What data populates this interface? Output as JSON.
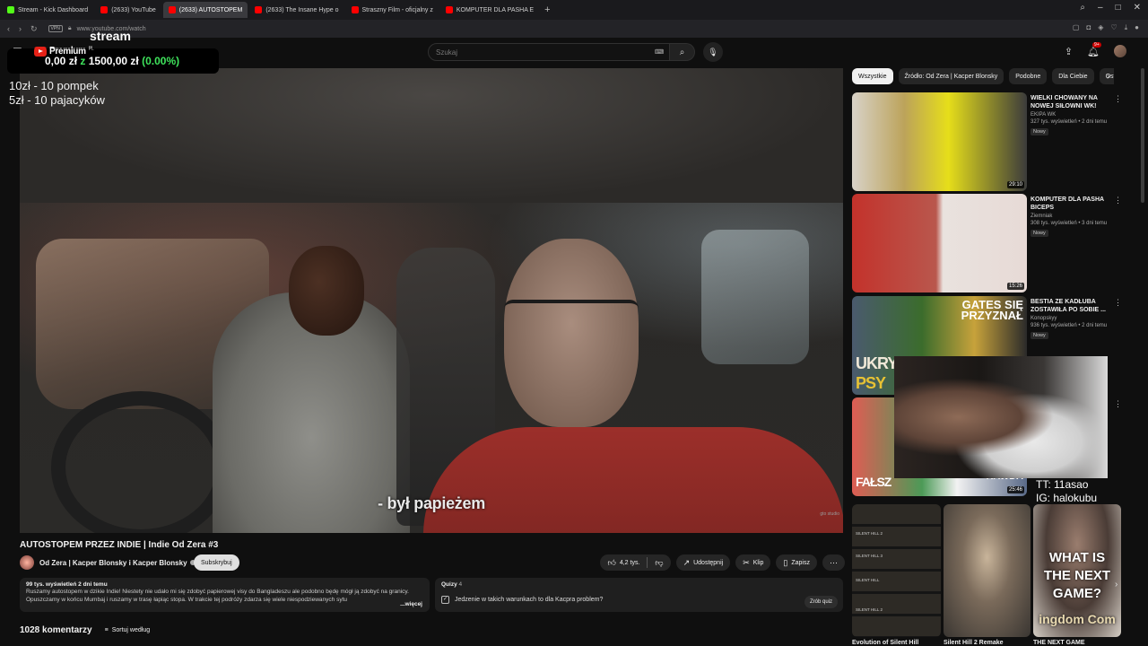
{
  "browser": {
    "tabs": [
      {
        "label": "Stream - Kick Dashboard",
        "color": "#53fc18"
      },
      {
        "label": "(2633) YouTube",
        "color": "#ff0000"
      },
      {
        "label": "(2633) AUTOSTOPEM",
        "color": "#ff0000"
      },
      {
        "label": "(2633) The Insane Hype o",
        "color": "#ff0000"
      },
      {
        "label": "Straszny Film - oficjalny z",
        "color": "#ff0000"
      },
      {
        "label": "KOMPUTER DLA PASHA E",
        "color": "#ff0000"
      }
    ],
    "url": "www.youtube.com/watch",
    "vpn": "VPN"
  },
  "overlay": {
    "stream_label": "stream",
    "donation_current": "0,00 zł",
    "donation_sep": "z",
    "donation_goal": "1500,00 zł",
    "donation_pct": "(0.00%)",
    "rule1": "10zł - 10 pompek",
    "rule2": "5zł - 10 pajacyków",
    "tt": "TT: 11asao",
    "ig": "IG: halokubu"
  },
  "masthead": {
    "logo": "Premium",
    "logo_region": "PL",
    "search_placeholder": "Szukaj",
    "notif_count": "9+"
  },
  "video": {
    "subtitle": "- był papieżem",
    "corner_tag": "gto studio",
    "title": "AUTOSTOPEM PRZEZ INDIE | Indie Od Zera #3",
    "channel": "Od Zera | Kacper Blonsky i Kacper Blonsky",
    "subscribe": "Subskrybuj",
    "likes": "4,2 tys.",
    "share": "Udostępnij",
    "clip": "Klip",
    "save": "Zapisz",
    "views_date": "99 tys. wyświetleń  2 dni temu",
    "description": "Ruszamy autostopem w dzikie Indie! Niestety nie udało mi się zdobyć papierowej visy do Bangladeszu ale podobno będę mógł ją zdobyć na granicy. Opuszczamy w końcu Mumbaj i ruszamy w trasę łapiąc stopa. W trakcie tej podróży zdarza się wiele niespodziewanych sytu",
    "more": "...więcej",
    "quiz_label": "Quizy",
    "quiz_count": "4",
    "quiz_question": "Jedzenie w takich warunkach to dla Kacpra problem?",
    "quiz_button": "Zrób quiz",
    "comments": "1028 komentarzy",
    "sort": "Sortuj według"
  },
  "chips": [
    "Wszystkie",
    "Źródło: Od Zera | Kacper Blonsky",
    "Podobne",
    "Dla Ciebie",
    "Ost"
  ],
  "recommendations": [
    {
      "title": "WIELKI CHOWANY NA NOWEJ SIŁOWNI WK!",
      "channel": "EKIPA WK",
      "views": "327 tys. wyświetleń • 2 dni temu",
      "badge": "Nowy",
      "duration": "29:10"
    },
    {
      "title": "KOMPUTER DLA PASHA BICEPS",
      "channel": "Ziemniak",
      "views": "308 tys. wyświetleń • 3 dni temu",
      "badge": "Nowy",
      "duration": "15:26"
    },
    {
      "title": "BESTIA ZE KADŁUBA ZOSTAWIŁA PO SOBIE ...",
      "channel": "Konopskyy",
      "views": "936 tys. wyświetleń • 2 dni temu",
      "badge": "Nowy",
      "duration": "",
      "thumb_left": "UKRYT",
      "thumb_left2": "PSY",
      "thumb_right": "GATES SIĘ PRZYZNAŁ"
    },
    {
      "title": "",
      "channel": "",
      "views": "",
      "badge": "",
      "duration": "25:46",
      "thumb_left": "FAŁSZ",
      "thumb_right": "RAWDA"
    }
  ],
  "shorts": [
    {
      "caption": "Evolution of Silent Hill",
      "labels": [
        "SILENT HILL 2",
        "SILENT HILL 3",
        "SILENT HILL",
        "SILENT HILL 2"
      ]
    },
    {
      "caption": "Silent Hill 2 Remake"
    },
    {
      "caption": "THE NEXT GAME",
      "overlay": "WHAT IS THE NEXT GAME?",
      "bottom": "ingdom Com"
    }
  ]
}
